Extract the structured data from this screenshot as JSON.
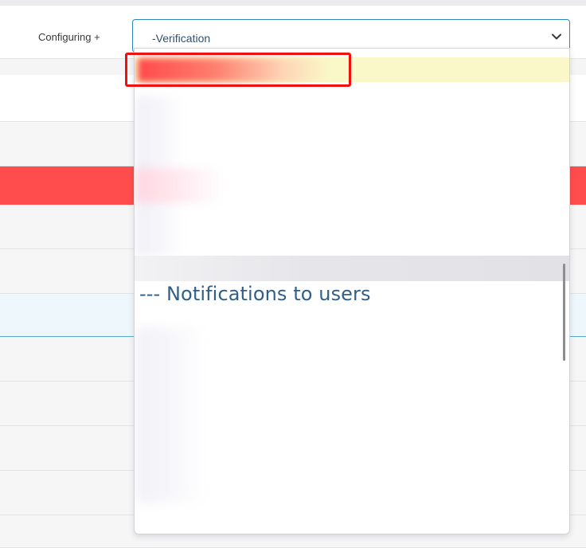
{
  "header": {
    "configuring_label": "Configuring +",
    "select": {
      "value": "-Verification",
      "border_color": "#2e86c1",
      "icon": "chevron-down-icon"
    }
  },
  "dropdown": {
    "group_heading": "--- Notifications to users",
    "highlight_color": "#faf8c8"
  },
  "table": {
    "row_colors": [
      "#ffffff",
      "#f6f6f7",
      "#ff4d4d",
      "#f6f6f7",
      "#f6f6f7",
      "#eef7fc",
      "#f6f6f7",
      "#f6f6f7",
      "#f6f6f7",
      "#f6f6f7",
      "#f6f6f7"
    ]
  },
  "annotation": {
    "color": "#ef1010"
  }
}
